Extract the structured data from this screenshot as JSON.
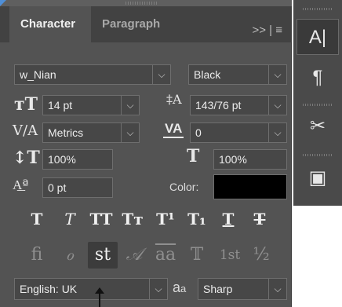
{
  "tabs": {
    "active": "Character",
    "inactive": "Paragraph",
    "menu": ">> | ≡"
  },
  "font": {
    "family": "w_Nian",
    "style": "Black"
  },
  "size": {
    "font_size": "14 pt",
    "leading": "143/76 pt"
  },
  "spacing": {
    "kerning": "Metrics",
    "tracking": "0"
  },
  "scale": {
    "vertical": "100%",
    "horizontal": "100%"
  },
  "baseline": {
    "shift": "0 pt",
    "color_label": "Color:",
    "color_value": "#000000"
  },
  "style_buttons": [
    "T",
    "T",
    "TT",
    "Tт",
    "T¹",
    "T₁",
    "T",
    "T"
  ],
  "opentype_buttons": [
    "fi",
    "ℴ",
    "st",
    "𝒜",
    "aa",
    "𝕋",
    "1st",
    "½"
  ],
  "bottom": {
    "language": "English: UK",
    "aa_label": "a",
    "aa_sub": "a",
    "antialias": "Sharp"
  },
  "rail": {
    "character_icon": "A|",
    "paragraph_icon": "¶",
    "tool_icon": "✂",
    "layers_icon": "▣"
  }
}
